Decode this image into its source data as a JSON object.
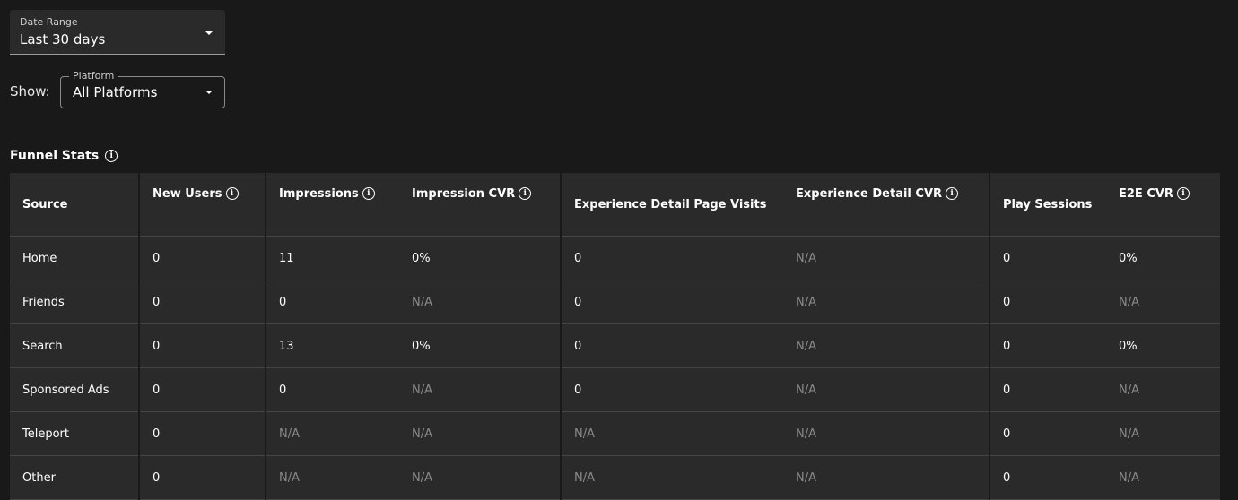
{
  "filters": {
    "date_range": {
      "label": "Date Range",
      "value": "Last 30 days"
    },
    "show_label": "Show:",
    "platform": {
      "label": "Platform",
      "value": "All Platforms"
    }
  },
  "section": {
    "title": "Funnel Stats"
  },
  "table": {
    "headers": [
      "Source",
      "New Users",
      "Impressions",
      "Impression CVR",
      "Experience Detail Page Visits",
      "Experience Detail CVR",
      "Play Sessions",
      "E2E CVR"
    ],
    "rows": [
      [
        "Home",
        "0",
        "11",
        "0%",
        "0",
        "N/A",
        "0",
        "0%"
      ],
      [
        "Friends",
        "0",
        "0",
        "N/A",
        "0",
        "N/A",
        "0",
        "N/A"
      ],
      [
        "Search",
        "0",
        "13",
        "0%",
        "0",
        "N/A",
        "0",
        "0%"
      ],
      [
        "Sponsored Ads",
        "0",
        "0",
        "N/A",
        "0",
        "N/A",
        "0",
        "N/A"
      ],
      [
        "Teleport",
        "0",
        "N/A",
        "N/A",
        "N/A",
        "N/A",
        "0",
        "N/A"
      ],
      [
        "Other",
        "0",
        "N/A",
        "N/A",
        "N/A",
        "N/A",
        "0",
        "N/A"
      ]
    ]
  }
}
